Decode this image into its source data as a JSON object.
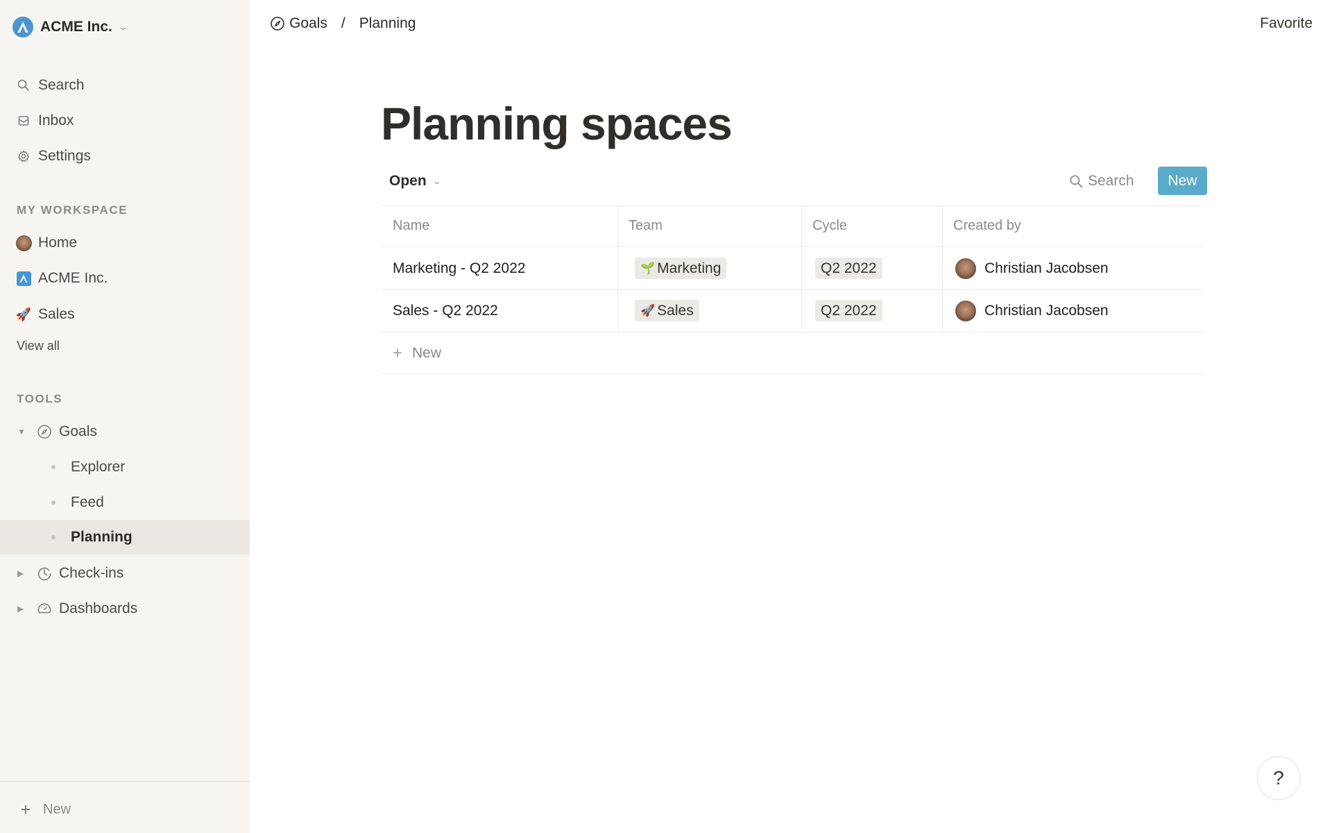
{
  "workspace": {
    "name": "ACME Inc.",
    "logo_letter": "A",
    "brand_color": "#4a95cf"
  },
  "sidebar": {
    "nav": [
      {
        "label": "Search",
        "icon": "search-icon"
      },
      {
        "label": "Inbox",
        "icon": "inbox-icon"
      },
      {
        "label": "Settings",
        "icon": "gear-icon"
      }
    ],
    "my_workspace_label": "MY WORKSPACE",
    "workspace_items": [
      {
        "label": "Home",
        "icon": "avatar-icon"
      },
      {
        "label": "ACME Inc.",
        "icon": "acme-logo-icon"
      },
      {
        "label": "Sales",
        "icon": "rocket-icon",
        "emoji": "🚀"
      }
    ],
    "view_all_label": "View all",
    "tools_label": "TOOLS",
    "tools": [
      {
        "label": "Goals",
        "icon": "compass-icon",
        "expanded": true,
        "children": [
          {
            "label": "Explorer",
            "active": false
          },
          {
            "label": "Feed",
            "active": false
          },
          {
            "label": "Planning",
            "active": true
          }
        ]
      },
      {
        "label": "Check-ins",
        "icon": "clock-icon",
        "expanded": false
      },
      {
        "label": "Dashboards",
        "icon": "gauge-icon",
        "expanded": false
      }
    ],
    "new_label": "New"
  },
  "topbar": {
    "breadcrumb": [
      {
        "label": "Goals",
        "icon": "compass-icon"
      },
      {
        "label": "Planning"
      }
    ],
    "separator": "/",
    "favorite_label": "Favorite"
  },
  "main": {
    "title": "Planning spaces",
    "filter": {
      "selected": "Open"
    },
    "search_label": "Search",
    "new_button_label": "New",
    "accent_color": "#5aabc9",
    "table": {
      "columns": [
        "Name",
        "Team",
        "Cycle",
        "Created by"
      ],
      "rows": [
        {
          "name": "Marketing - Q2 2022",
          "team": {
            "emoji": "🌱",
            "label": "Marketing"
          },
          "cycle": "Q2 2022",
          "created_by": "Christian Jacobsen"
        },
        {
          "name": "Sales - Q2 2022",
          "team": {
            "emoji": "🚀",
            "label": "Sales"
          },
          "cycle": "Q2 2022",
          "created_by": "Christian Jacobsen"
        }
      ],
      "new_row_label": "New"
    }
  },
  "help": {
    "label": "?"
  }
}
